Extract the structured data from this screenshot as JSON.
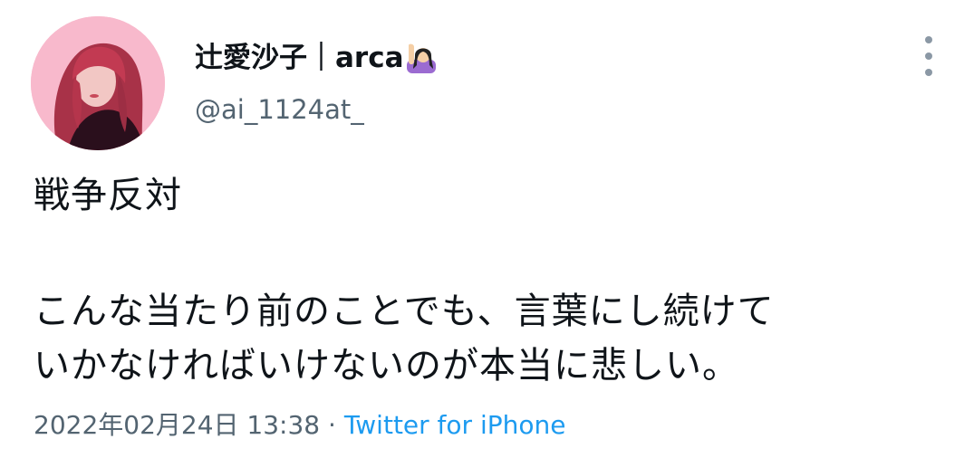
{
  "author": {
    "display_name": "辻愛沙子｜arca",
    "emoji_icon": "raising-hand-woman-icon",
    "handle": "@ai_1124at_"
  },
  "tweet": {
    "line1": "戦争反対",
    "line2": "こんな当たり前のことでも、言葉にし続けて",
    "line3": "いかなければいけないのが本当に悲しい。"
  },
  "meta": {
    "timestamp": "2022年02月24日 13:38",
    "separator": " · ",
    "source": "Twitter for iPhone"
  },
  "colors": {
    "text": "#0f1419",
    "secondary": "#536471",
    "link": "#1d9bf0",
    "avatar_bg": "#f7b3c8"
  }
}
